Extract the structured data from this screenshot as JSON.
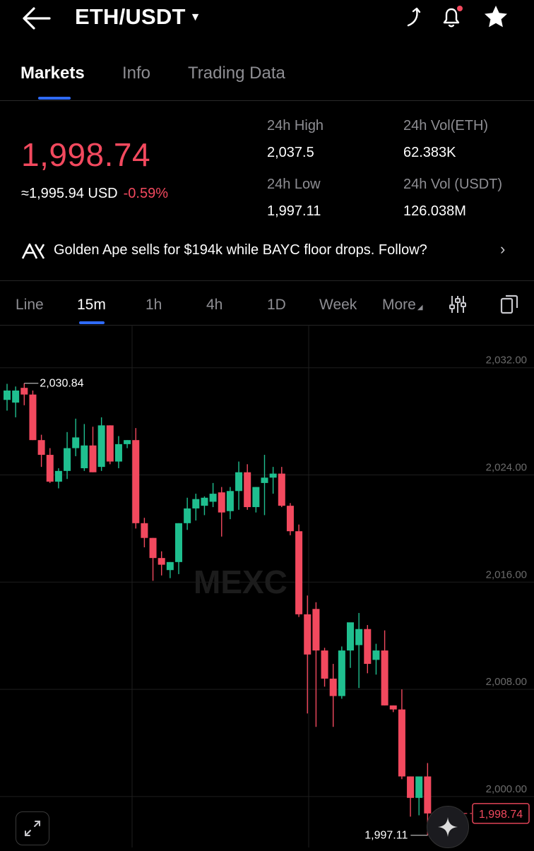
{
  "header": {
    "pair": "ETH/USDT",
    "icons": [
      "back-arrow-icon",
      "share-icon",
      "bell-icon",
      "star-icon"
    ]
  },
  "tabs": [
    "Markets",
    "Info",
    "Trading Data"
  ],
  "ticker": {
    "last_price": "1,998.74",
    "usd_price": "≈1,995.94 USD",
    "change": "-0.59%",
    "high_label": "24h High",
    "high_value": "2,037.5",
    "low_label": "24h Low",
    "low_value": "1,997.11",
    "vol_eth_label": "24h Vol(ETH)",
    "vol_eth_value": "62.383K",
    "vol_usdt_label": "24h Vol (USDT)",
    "vol_usdt_value": "126.038M",
    "colors": {
      "down": "#f2495e",
      "up": "#1fbf8f"
    }
  },
  "news": {
    "text": "Golden Ape sells for $194k while BAYC floor drops. Follow?"
  },
  "intervals": {
    "items": [
      "Line",
      "15m",
      "1h",
      "4h",
      "1D",
      "Week",
      "More"
    ],
    "active": "15m"
  },
  "chart_data": {
    "type": "candlestick",
    "watermark": "MEXC",
    "ylim": [
      1996.2,
      2035.2
    ],
    "y_ticks": [
      2032,
      2024,
      2016,
      2008,
      2000
    ],
    "y_tick_labels": [
      "2,032.00",
      "2,024.00",
      "2,016.00",
      "2,008.00",
      "2,000.00"
    ],
    "high_marker": "2,030.84",
    "low_marker": "1,997.11",
    "last_price_label": "1,998.74",
    "last_price": 1998.74,
    "candles": [
      {
        "o": 2029.6,
        "h": 2030.8,
        "l": 2028.8,
        "c": 2030.3
      },
      {
        "o": 2029.4,
        "h": 2030.6,
        "l": 2028.3,
        "c": 2030.3
      },
      {
        "o": 2030.5,
        "h": 2030.84,
        "l": 2029.2,
        "c": 2030.0
      },
      {
        "o": 2030.0,
        "h": 2030.3,
        "l": 2026.6,
        "c": 2026.6
      },
      {
        "o": 2026.6,
        "h": 2027.0,
        "l": 2024.6,
        "c": 2025.5
      },
      {
        "o": 2025.5,
        "h": 2026.0,
        "l": 2023.4,
        "c": 2023.5
      },
      {
        "o": 2023.5,
        "h": 2024.5,
        "l": 2023.0,
        "c": 2024.3
      },
      {
        "o": 2024.3,
        "h": 2027.2,
        "l": 2023.7,
        "c": 2026.0
      },
      {
        "o": 2026.0,
        "h": 2028.2,
        "l": 2025.4,
        "c": 2026.8
      },
      {
        "o": 2024.5,
        "h": 2027.8,
        "l": 2024.3,
        "c": 2026.2
      },
      {
        "o": 2026.2,
        "h": 2027.6,
        "l": 2024.2,
        "c": 2024.2
      },
      {
        "o": 2024.6,
        "h": 2028.3,
        "l": 2024.3,
        "c": 2027.7
      },
      {
        "o": 2027.7,
        "h": 2027.7,
        "l": 2024.8,
        "c": 2025.0
      },
      {
        "o": 2025.0,
        "h": 2026.9,
        "l": 2024.5,
        "c": 2026.3
      },
      {
        "o": 2026.3,
        "h": 2026.6,
        "l": 2026.0,
        "c": 2026.6
      },
      {
        "o": 2026.6,
        "h": 2027.5,
        "l": 2020.0,
        "c": 2020.4
      },
      {
        "o": 2020.4,
        "h": 2020.8,
        "l": 2018.6,
        "c": 2019.3
      },
      {
        "o": 2019.3,
        "h": 2019.3,
        "l": 2016.1,
        "c": 2017.8
      },
      {
        "o": 2017.8,
        "h": 2018.3,
        "l": 2016.5,
        "c": 2017.3
      },
      {
        "o": 2016.9,
        "h": 2017.5,
        "l": 2016.3,
        "c": 2017.5
      },
      {
        "o": 2017.5,
        "h": 2020.4,
        "l": 2016.6,
        "c": 2020.4
      },
      {
        "o": 2020.4,
        "h": 2022.3,
        "l": 2019.9,
        "c": 2021.5
      },
      {
        "o": 2021.5,
        "h": 2022.6,
        "l": 2020.6,
        "c": 2022.2
      },
      {
        "o": 2021.7,
        "h": 2022.4,
        "l": 2021.0,
        "c": 2022.3
      },
      {
        "o": 2022.0,
        "h": 2023.4,
        "l": 2021.6,
        "c": 2022.6
      },
      {
        "o": 2022.7,
        "h": 2023.1,
        "l": 2019.4,
        "c": 2021.2
      },
      {
        "o": 2021.3,
        "h": 2023.1,
        "l": 2020.7,
        "c": 2022.8
      },
      {
        "o": 2022.8,
        "h": 2025.0,
        "l": 2021.4,
        "c": 2024.2
      },
      {
        "o": 2024.2,
        "h": 2024.8,
        "l": 2021.4,
        "c": 2021.6
      },
      {
        "o": 2021.6,
        "h": 2023.1,
        "l": 2021.2,
        "c": 2023.1
      },
      {
        "o": 2023.4,
        "h": 2025.5,
        "l": 2021.0,
        "c": 2023.8
      },
      {
        "o": 2023.8,
        "h": 2024.6,
        "l": 2022.6,
        "c": 2024.1
      },
      {
        "o": 2024.1,
        "h": 2024.6,
        "l": 2021.6,
        "c": 2021.7
      },
      {
        "o": 2021.7,
        "h": 2021.9,
        "l": 2019.5,
        "c": 2019.8
      },
      {
        "o": 2019.8,
        "h": 2020.3,
        "l": 2013.4,
        "c": 2013.6
      },
      {
        "o": 2013.6,
        "h": 2015.0,
        "l": 2006.2,
        "c": 2010.6
      },
      {
        "o": 2014.0,
        "h": 2014.5,
        "l": 2005.2,
        "c": 2010.9
      },
      {
        "o": 2010.9,
        "h": 2011.1,
        "l": 2008.2,
        "c": 2008.8
      },
      {
        "o": 2008.8,
        "h": 2009.9,
        "l": 2005.2,
        "c": 2007.5
      },
      {
        "o": 2007.5,
        "h": 2011.2,
        "l": 2007.3,
        "c": 2010.9
      },
      {
        "o": 2010.9,
        "h": 2012.7,
        "l": 2009.6,
        "c": 2013.0
      },
      {
        "o": 2011.3,
        "h": 2013.7,
        "l": 2008.1,
        "c": 2012.5
      },
      {
        "o": 2012.5,
        "h": 2012.8,
        "l": 2009.2,
        "c": 2009.9
      },
      {
        "o": 2010.2,
        "h": 2011.4,
        "l": 2009.1,
        "c": 2010.9
      },
      {
        "o": 2010.9,
        "h": 2012.4,
        "l": 2006.8,
        "c": 2006.8
      },
      {
        "o": 2006.8,
        "h": 2006.8,
        "l": 2006.3,
        "c": 2006.5
      },
      {
        "o": 2006.5,
        "h": 2008.0,
        "l": 2001.3,
        "c": 2001.5
      },
      {
        "o": 2001.5,
        "h": 2001.5,
        "l": 1998.5,
        "c": 1999.9
      },
      {
        "o": 1999.9,
        "h": 2001.1,
        "l": 1998.6,
        "c": 2001.5
      },
      {
        "o": 2001.5,
        "h": 2002.5,
        "l": 1997.11,
        "c": 1998.74
      }
    ]
  }
}
